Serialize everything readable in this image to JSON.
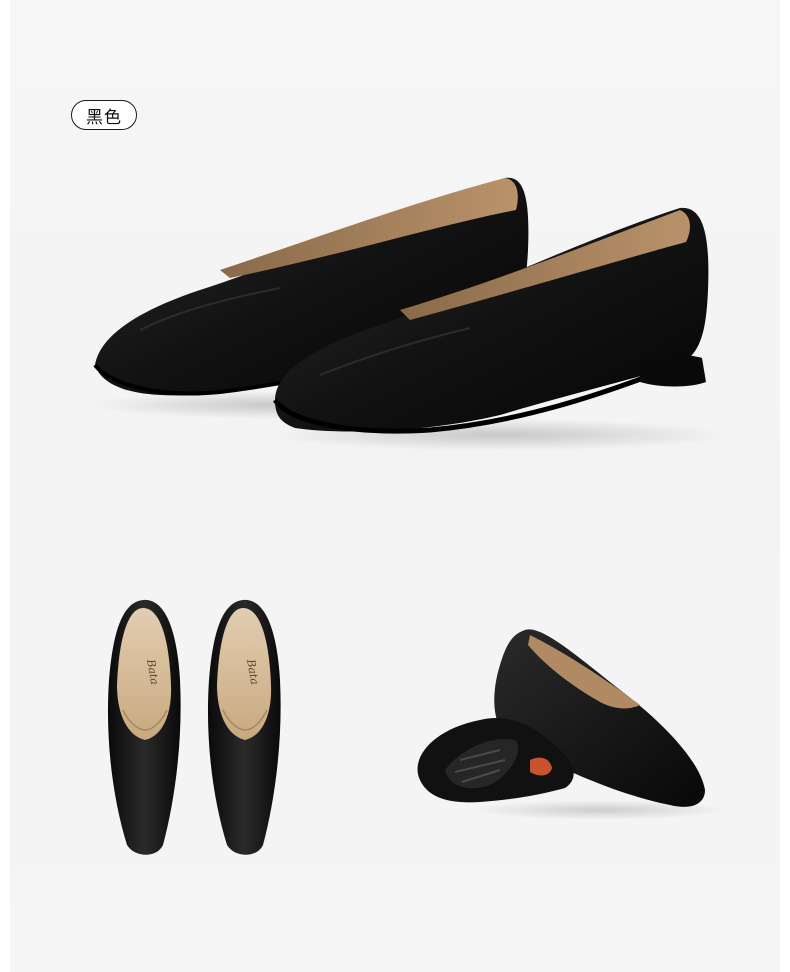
{
  "color_tag": {
    "label": "黑色"
  },
  "photos": {
    "hero": {
      "icon": "black-flat-shoes-pair-side-icon"
    },
    "top_view": {
      "icon": "black-flat-shoes-top-view-icon",
      "insole_logo": "Bata"
    },
    "angle_view": {
      "icon": "black-flat-shoes-sole-angle-icon"
    }
  },
  "colors": {
    "leather": "#111111",
    "lining": "#b08a62",
    "insole": "#d9c2a3",
    "background": "#f5f5f5"
  }
}
